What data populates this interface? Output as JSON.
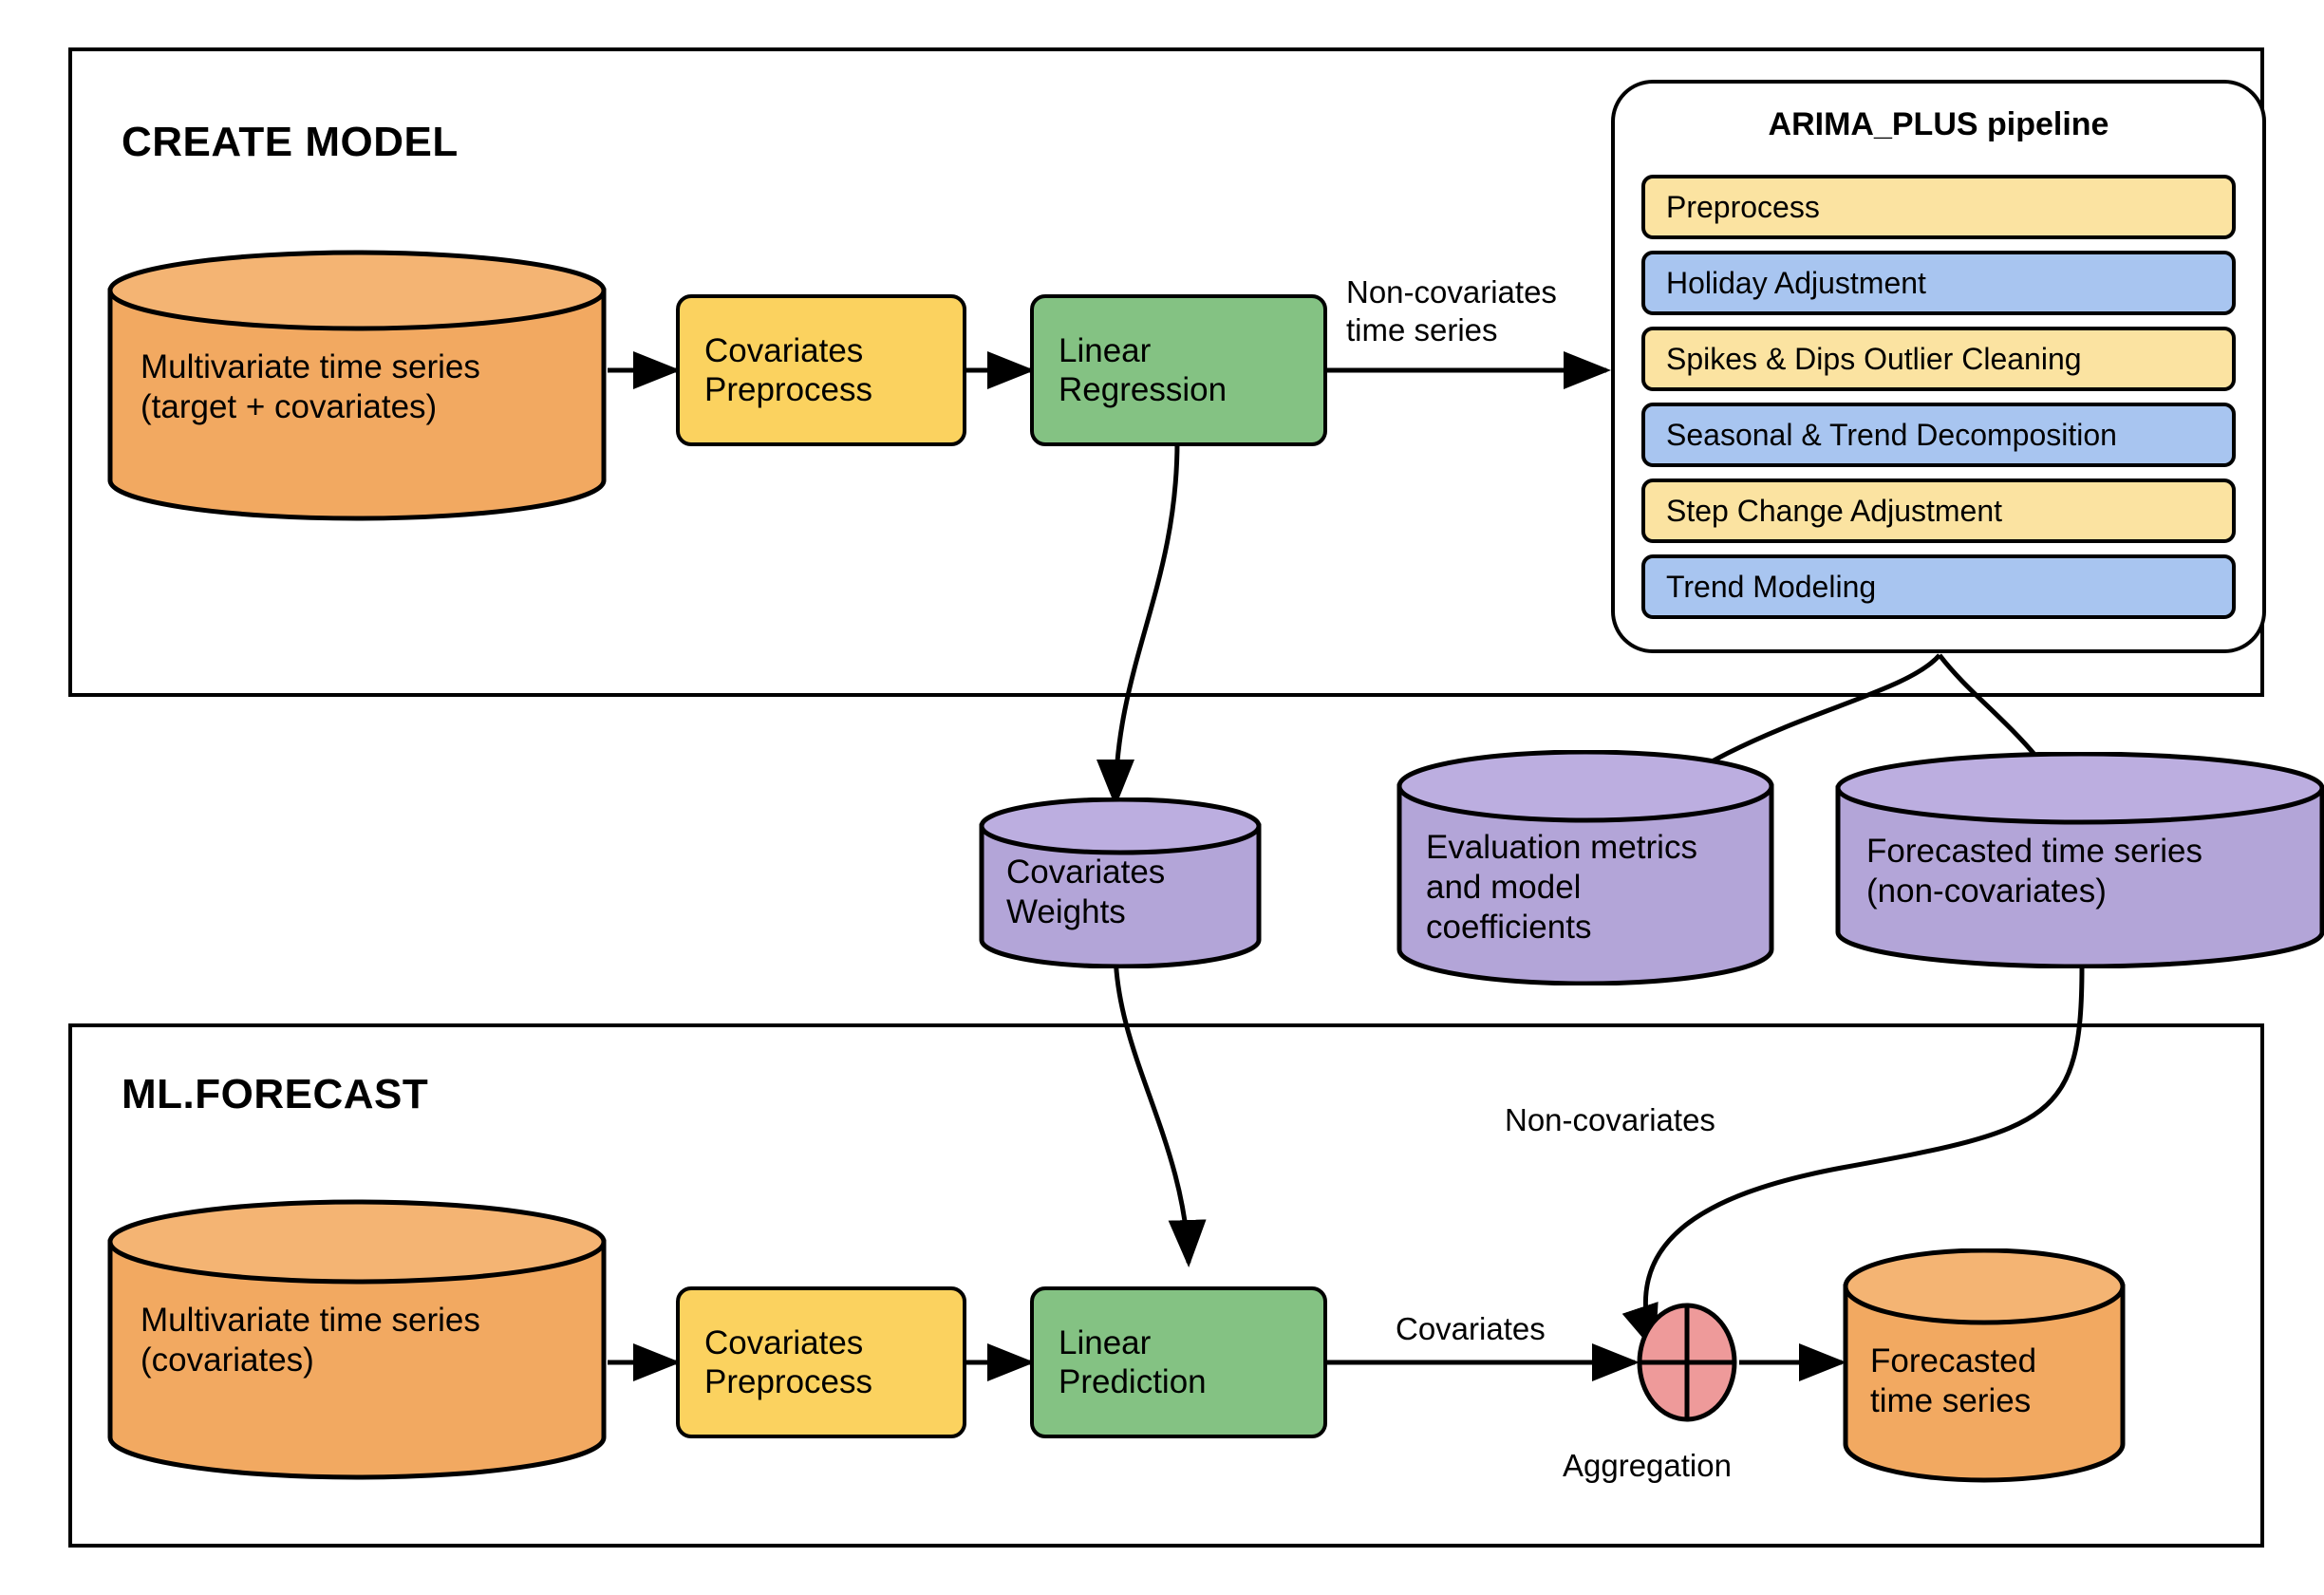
{
  "diagram": {
    "sections": [
      {
        "id": "create-model",
        "title": "CREATE MODEL"
      },
      {
        "id": "ml-forecast",
        "title": "ML.FORECAST"
      }
    ],
    "create_model": {
      "input_store": {
        "line1": "Multivariate time series",
        "line2": "(target + covariates)"
      },
      "preprocess_box": {
        "line1": "Covariates",
        "line2": "Preprocess"
      },
      "regression_box": {
        "line1": "Linear",
        "line2": "Regression"
      },
      "edge_label_noncov": {
        "line1": "Non-covariates",
        "line2": "time series"
      }
    },
    "pipeline": {
      "title": "ARIMA_PLUS pipeline",
      "steps": [
        {
          "label": "Preprocess",
          "color": "yellow"
        },
        {
          "label": "Holiday Adjustment",
          "color": "blue"
        },
        {
          "label": "Spikes & Dips Outlier Cleaning",
          "color": "yellow"
        },
        {
          "label": "Seasonal & Trend Decomposition",
          "color": "blue"
        },
        {
          "label": "Step Change Adjustment",
          "color": "yellow"
        },
        {
          "label": "Trend Modeling",
          "color": "blue"
        }
      ]
    },
    "outputs": {
      "covariates_weights": {
        "line1": "Covariates",
        "line2": "Weights"
      },
      "evaluation_metrics": {
        "line1": "Evaluation metrics",
        "line2": "and model",
        "line3": "coefficients"
      },
      "forecasted_noncov": {
        "line1": "Forecasted time series",
        "line2": "(non-covariates)"
      }
    },
    "ml_forecast": {
      "input_store": {
        "line1": "Multivariate time series",
        "line2": "(covariates)"
      },
      "preprocess_box": {
        "line1": "Covariates",
        "line2": "Preprocess"
      },
      "prediction_box": {
        "line1": "Linear",
        "line2": "Prediction"
      },
      "edge_label_covariates": "Covariates",
      "edge_label_noncovariates": "Non-covariates",
      "aggregation_label": "Aggregation",
      "output_store": {
        "line1": "Forecasted",
        "line2": "time series"
      }
    },
    "colors": {
      "orange_fill": "#F2A961",
      "orange_top": "#F4B473",
      "yellow_box": "#FBD25F",
      "yellow_step": "#FBE3A1",
      "blue_step": "#A8C5F0",
      "green_box": "#84C283",
      "purple_fill": "#B3A5D8",
      "purple_top": "#BCAEE0",
      "pink_node": "#EE9A9A",
      "stroke": "#000000"
    }
  }
}
